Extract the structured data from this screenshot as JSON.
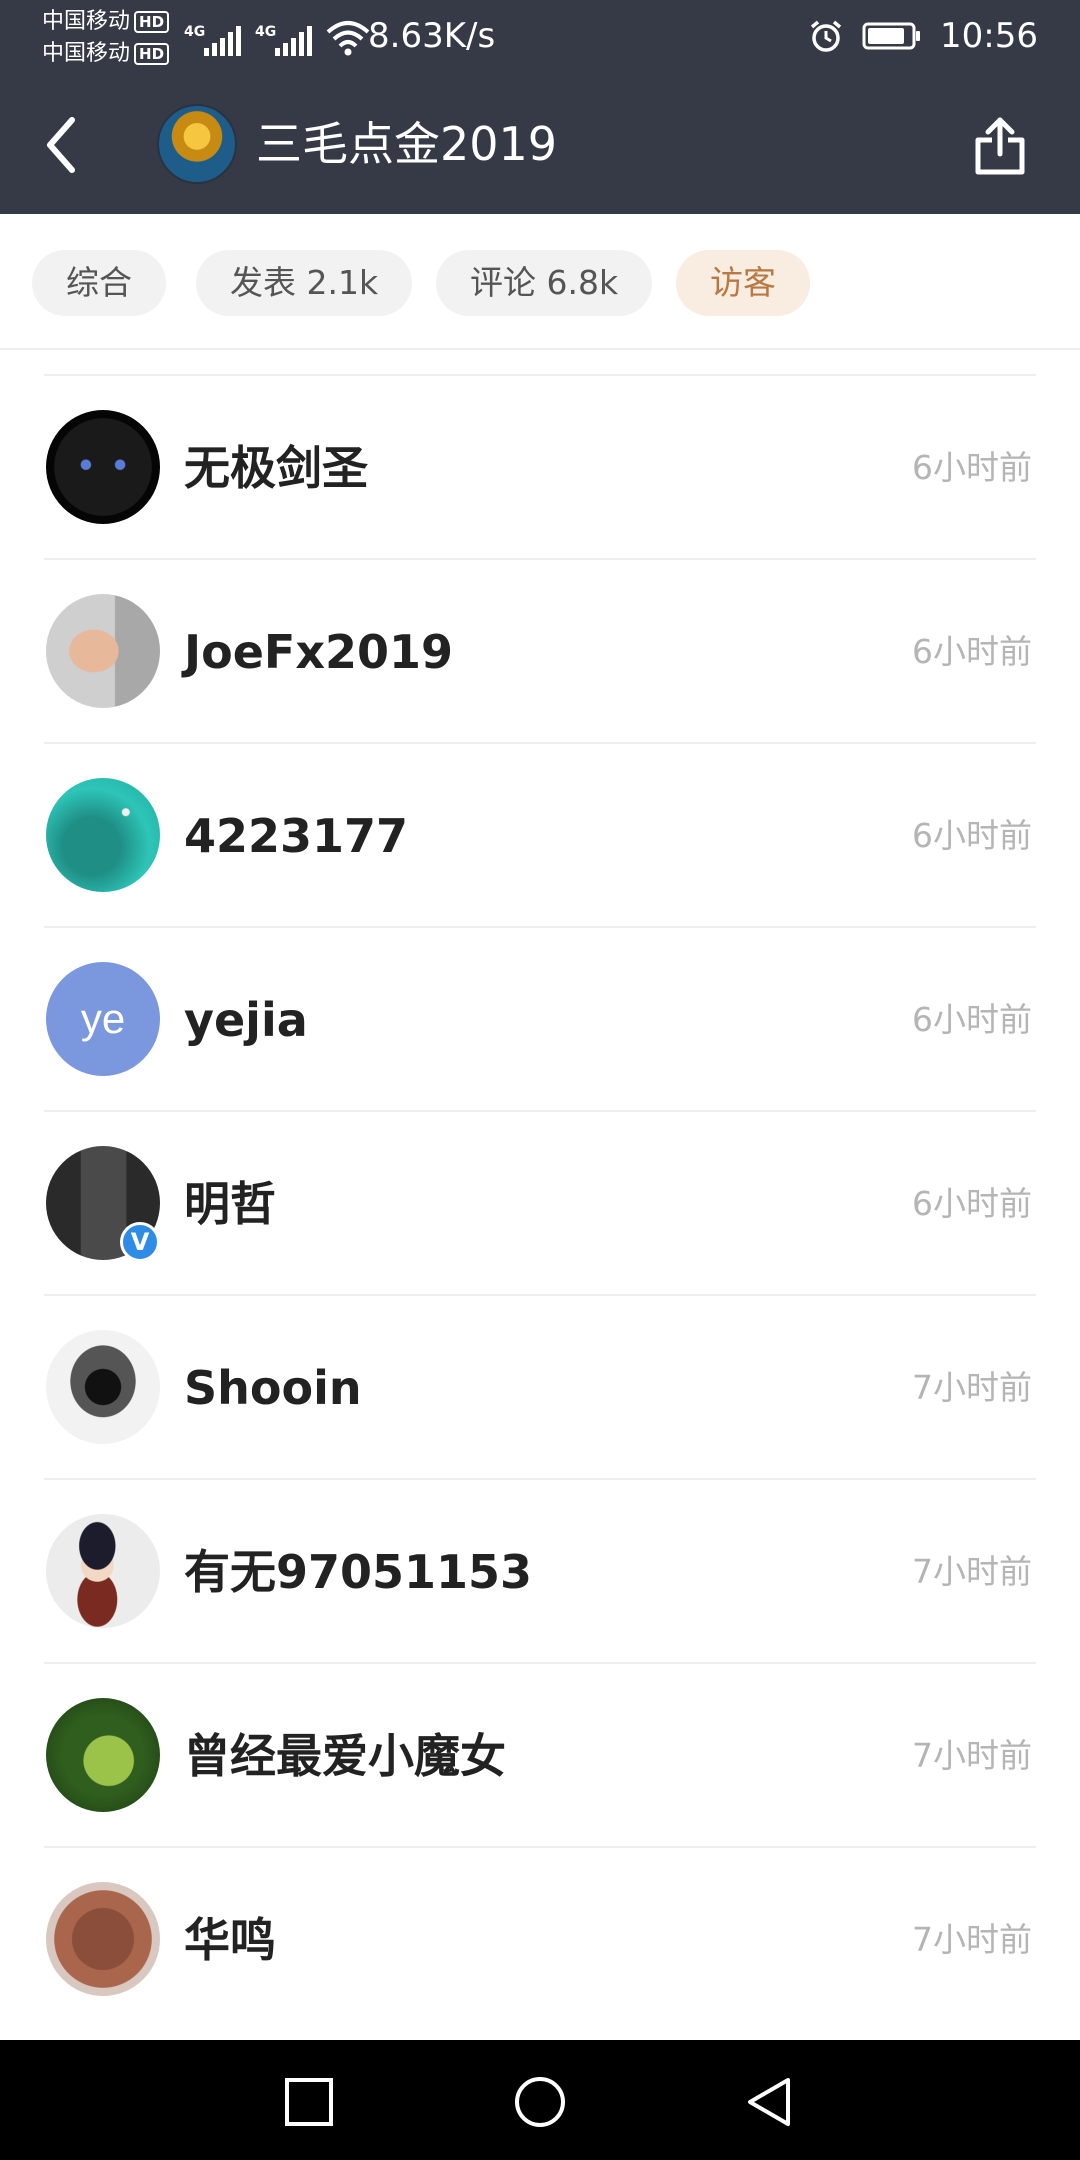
{
  "status_bar": {
    "carrier_1": "中国移动",
    "carrier_2": "中国移动",
    "hd_label": "HD",
    "network_type": "4G",
    "net_speed": "8.63K/s",
    "time": "10:56"
  },
  "header": {
    "profile_name": "三毛点金2019"
  },
  "tabs": [
    {
      "label": "综合",
      "active": false
    },
    {
      "label": "发表 2.1k",
      "active": false
    },
    {
      "label": "评论 6.8k",
      "active": false
    },
    {
      "label": "访客",
      "active": true
    }
  ],
  "visitors": [
    {
      "name": "无极剑圣",
      "time": "6小时前",
      "avatar": "black-cat-avatar"
    },
    {
      "name": "JoeFx2019",
      "time": "6小时前",
      "avatar": "man-portrait-avatar"
    },
    {
      "name": "4223177",
      "time": "6小时前",
      "avatar": "turquoise-sea-avatar"
    },
    {
      "name": "yejia",
      "time": "6小时前",
      "avatar": "initials-avatar",
      "initials": "ye"
    },
    {
      "name": "明哲",
      "time": "6小时前",
      "avatar": "man-suit-avatar",
      "verified_badge": "V"
    },
    {
      "name": "Shooin",
      "time": "7小时前",
      "avatar": "eagle-crest-avatar"
    },
    {
      "name": "有无97051153",
      "time": "7小时前",
      "avatar": "anime-character-avatar"
    },
    {
      "name": "曾经最爱小魔女",
      "time": "7小时前",
      "avatar": "frog-avatar"
    },
    {
      "name": "华鸣",
      "time": "7小时前",
      "avatar": "coin-avatar"
    }
  ],
  "colors": {
    "header_bg": "#353a46",
    "active_tab_bg": "#f9ece0",
    "active_tab_text": "#b87a45",
    "initials_avatar_bg": "#7b97dd",
    "verified_badge_bg": "#2e8ce6"
  }
}
